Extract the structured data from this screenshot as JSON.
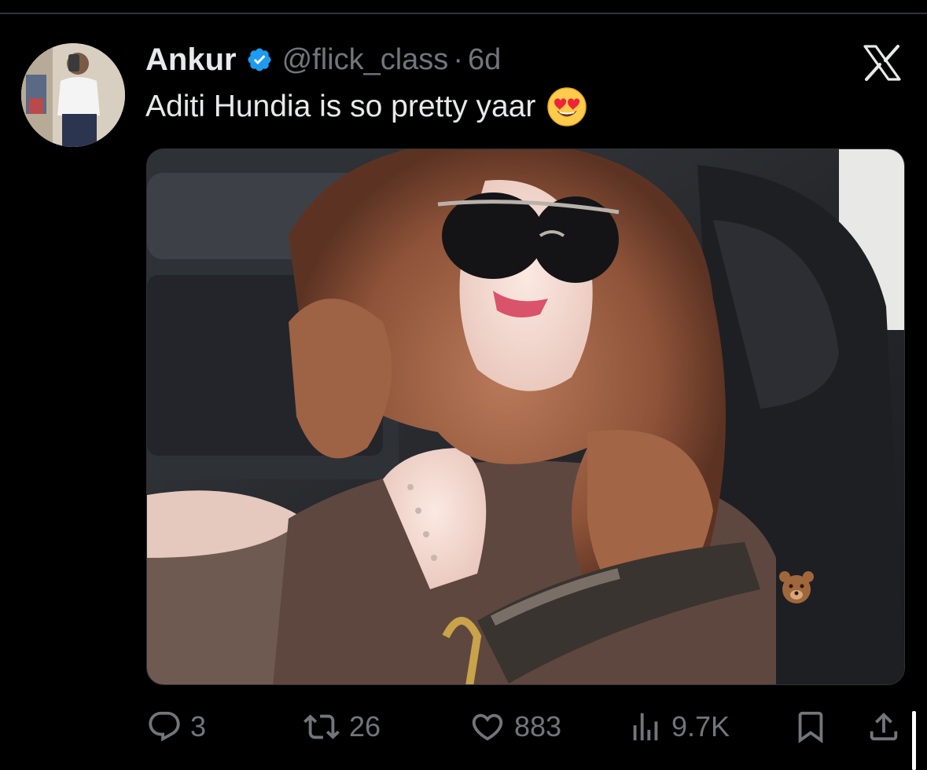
{
  "tweet": {
    "display_name": "Ankur",
    "handle": "@flick_class",
    "separator": "·",
    "timestamp": "6d",
    "text": "Aditi Hundia is so pretty yaar",
    "emoji": "smiling-face-with-heart-eyes",
    "verified": true
  },
  "actions": {
    "replies": "3",
    "reposts": "26",
    "likes": "883",
    "views": "9.7K"
  },
  "icons": {
    "reply": "reply-icon",
    "repost": "repost-icon",
    "like": "heart-icon",
    "views": "views-icon",
    "bookmark": "bookmark-icon",
    "share": "share-icon",
    "platform": "x-logo-icon",
    "verified": "verified-badge-icon",
    "media_sticker": "bear-emoji"
  },
  "colors": {
    "background": "#000000",
    "text_primary": "#e7e9ea",
    "text_secondary": "#71767b",
    "verified_blue": "#1d9bf0",
    "divider": "#2f3336"
  }
}
